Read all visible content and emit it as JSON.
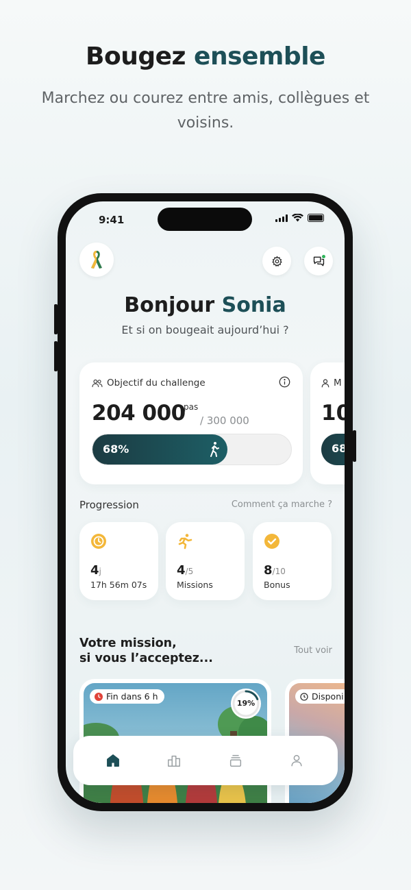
{
  "promo": {
    "title_part1": "Bougez",
    "title_part2": "ensemble",
    "subtitle": "Marchez ou courez entre amis, collègues et voisins."
  },
  "status_bar": {
    "time": "9:41"
  },
  "header": {
    "logo_icon": "ribbon-logo-icon",
    "settings_icon": "gear-icon",
    "chat_icon": "chat-bubbles-icon",
    "has_notification": true
  },
  "greeting": {
    "hello": "Bonjour",
    "name": "Sonia",
    "subtitle": "Et si on bougeait aujourd’hui ?"
  },
  "challenge_card": {
    "label": "Objectif du challenge",
    "steps": "204 000",
    "unit": "pas",
    "goal": "/ 300 000",
    "progress_label": "68%",
    "progress": 0.68
  },
  "peek_card": {
    "label": "M",
    "value": "10",
    "progress_label": "68"
  },
  "progression": {
    "title": "Progression",
    "help_link": "Comment ça marche ?",
    "stats": [
      {
        "icon": "timer-icon",
        "value": "4",
        "suffix": "j",
        "label": "17h 56m 07s"
      },
      {
        "icon": "runner-icon",
        "value": "4",
        "suffix": "/5",
        "label": "Missions"
      },
      {
        "icon": "check-badge-icon",
        "value": "8",
        "suffix": "/10",
        "label": "Bonus"
      }
    ]
  },
  "missions": {
    "title_line1": "Votre mission,",
    "title_line2": "si vous l’acceptez...",
    "see_all": "Tout voir",
    "cards": [
      {
        "badge": "Fin dans 6 h",
        "badge_color": "#e0443a",
        "progress_label": "19%",
        "progress": 0.19
      },
      {
        "badge": "Disponi"
      }
    ]
  },
  "tabbar": {
    "tabs": [
      {
        "icon": "home-icon",
        "active": true
      },
      {
        "icon": "leaderboard-icon",
        "active": false
      },
      {
        "icon": "cards-stack-icon",
        "active": false
      },
      {
        "icon": "profile-icon",
        "active": false
      }
    ]
  },
  "colors": {
    "brand": "#1d4f57",
    "accent_gold": "#f3b73a",
    "notification": "#2fb45a"
  }
}
